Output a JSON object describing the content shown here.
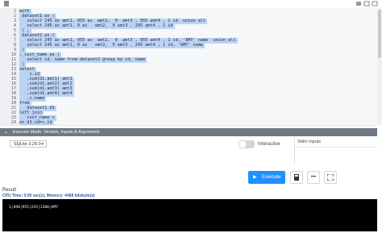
{
  "editor": {
    "lines": [
      {
        "n": "1",
        "text": "with"
      },
      {
        "n": "2",
        "text": " dataset1 as ("
      },
      {
        "n": "3",
        "text": "   select 245 as amt1, 955 as  amt2,  0  amt3 , 955 amt4 , 1 id  union all"
      },
      {
        "n": "4",
        "text": "   select 245 as amt1, 0 as   amt2,  0 amt3 , 245 amt4 , 1 id"
      },
      {
        "n": "5",
        "text": " ) ,"
      },
      {
        "n": "6",
        "text": " dataset2 as ("
      },
      {
        "n": "7",
        "text": "   select 245 as amt1, 955 as  amt2,  0  amt3 , 955 amt4 , 1 id, 'AMY' name  union all"
      },
      {
        "n": "8",
        "text": "   select 245 as amt1, 0 as   amt2,  0 amt3 , 245 amt4 , 1 id, 'AMY' name"
      },
      {
        "n": "9",
        "text": " )"
      },
      {
        "n": "10",
        "text": ", cust_name as ("
      },
      {
        "n": "11",
        "text": "   select id, name from dataset2 group by id, name"
      },
      {
        "n": "12",
        "text": " )"
      },
      {
        "n": "13",
        "text": "select"
      },
      {
        "n": "14",
        "text": "    c.id"
      },
      {
        "n": "15",
        "text": "   ,sum(d1.amt1) amt1"
      },
      {
        "n": "16",
        "text": "   ,sum(d1.amt2) amt2"
      },
      {
        "n": "17",
        "text": "   ,sum(d1.amt3) amt3"
      },
      {
        "n": "18",
        "text": "   ,sum(d1.amt4) amt4"
      },
      {
        "n": "19",
        "text": "   ,c.name"
      },
      {
        "n": "20",
        "text": "from"
      },
      {
        "n": "21",
        "text": "   dataset1 d1"
      },
      {
        "n": "22",
        "text": "left join"
      },
      {
        "n": "23",
        "text": "   cust_name c"
      },
      {
        "n": "24",
        "text": "on d1.id=c.id"
      }
    ]
  },
  "section": {
    "chevron": "⌄",
    "title": "Execute Mode, Version, Inputs & Arguments"
  },
  "version_select": {
    "value": "SQLite 3.29.0"
  },
  "interactive": {
    "label": "Interactive"
  },
  "stdin": {
    "label": "Stdin Inputs"
  },
  "execute_button": {
    "label": "Execute"
  },
  "result": {
    "label": "Result",
    "cpu": "CPU Time: 0.00 sec(s), Memory: 4468 kilobyte(s)",
    "output": "1|490|955|245|1200|AMY"
  },
  "colors": {
    "selection": "#bcd3f2",
    "accent": "#1e90ff",
    "section_bg": "#6f7782"
  }
}
